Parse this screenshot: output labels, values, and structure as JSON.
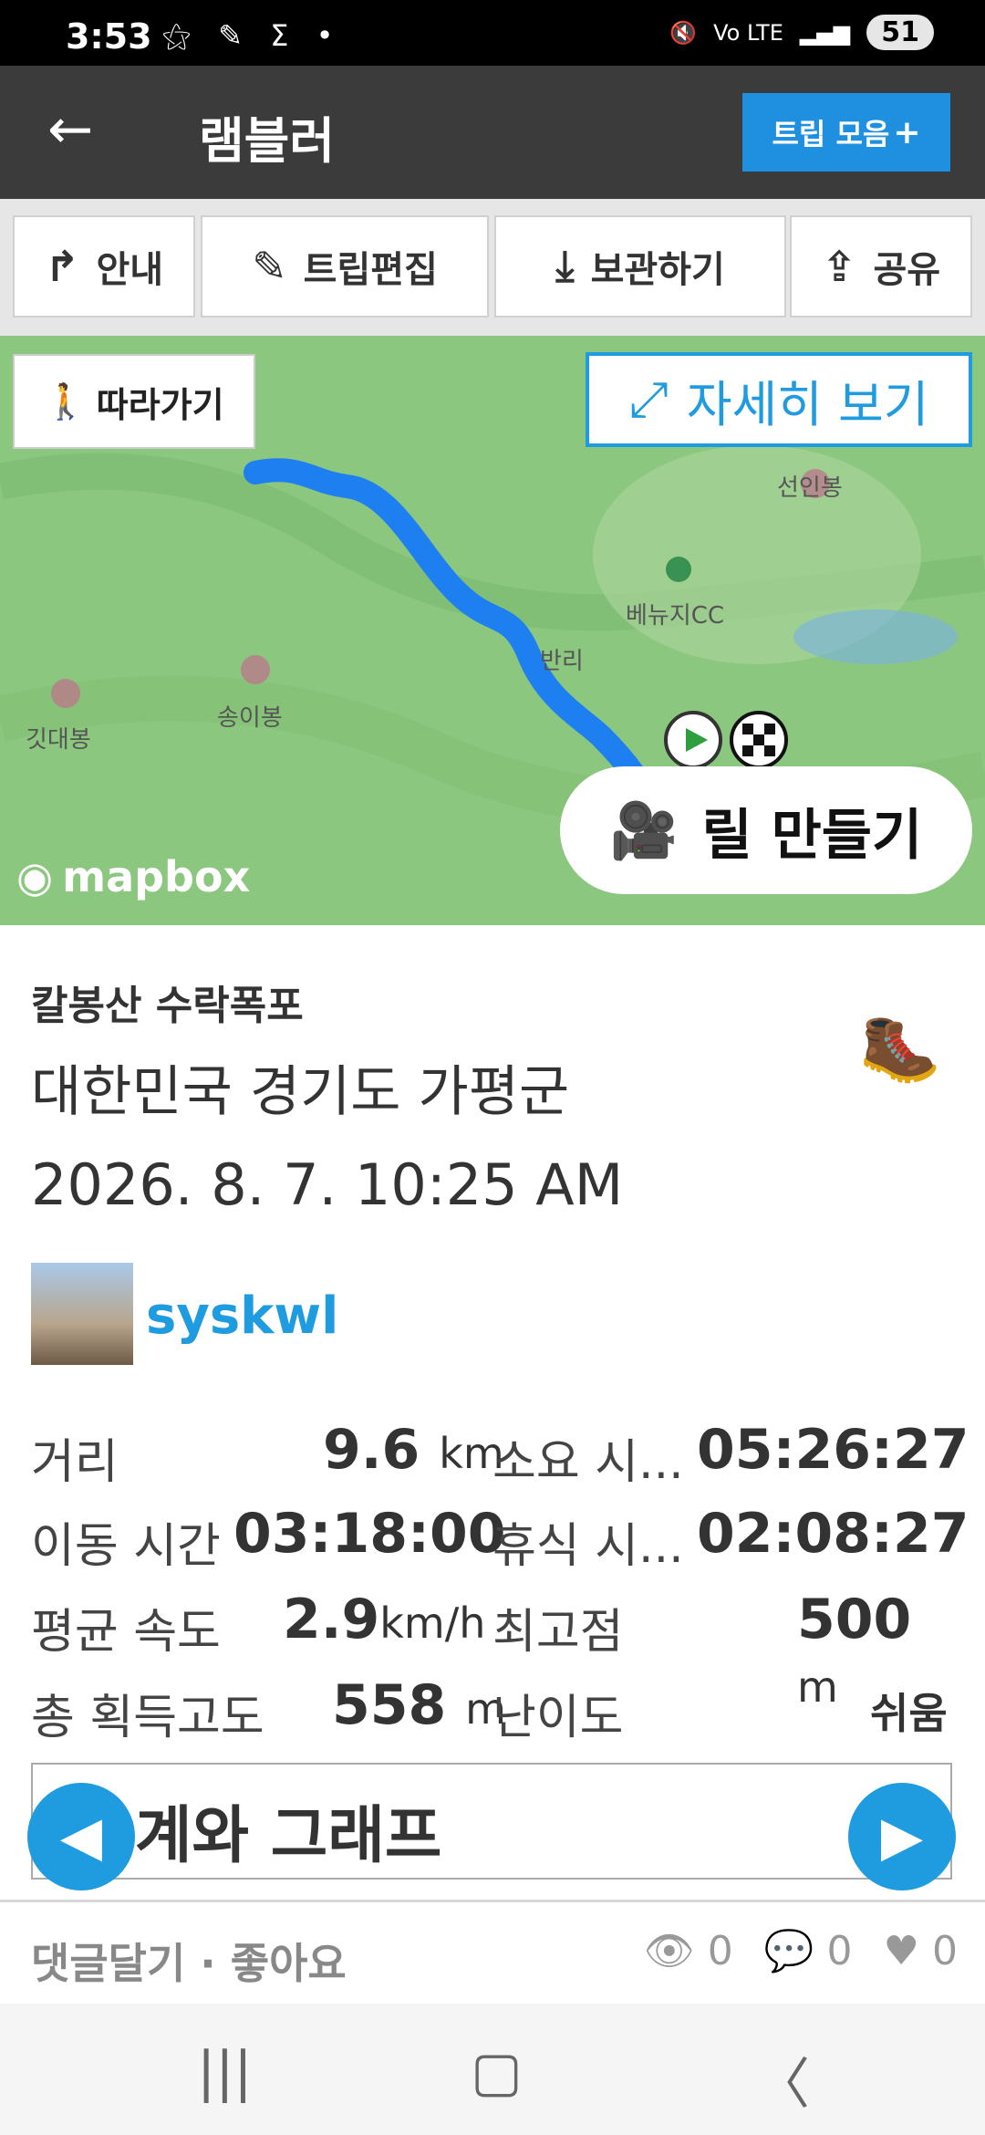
{
  "status_bar": {
    "time": "3:53",
    "left_icons": "⚝ ✎ Σ •",
    "signal": "Vo LTE",
    "battery": "51"
  },
  "app_bar": {
    "title": "램블러",
    "trips_button": "트립 모음"
  },
  "toolbar": {
    "guide": "안내",
    "edit_trip": "트립편집",
    "save": "보관하기",
    "share": "공유"
  },
  "map": {
    "follow": "따라가기",
    "detail_view": "자세히 보기",
    "labels": {
      "peak1": "선인봉",
      "cc": "베뉴지CC",
      "village": "반리",
      "peak2": "송이봉",
      "peak3": "깃대봉"
    },
    "mapbox": "mapbox",
    "reel_button": "릴 만들기"
  },
  "trip": {
    "name": "칼봉산 수락폭포",
    "location": "대한민국 경기도 가평군",
    "datetime": "2026. 8. 7. 10:25 AM",
    "username": "syskwl"
  },
  "stats": {
    "distance_label": "거리",
    "distance_value": "9.6",
    "distance_unit": "km",
    "duration_label": "소요 시...",
    "duration_value": "05:26:27",
    "moving_label": "이동 시간",
    "moving_value": "03:18:00",
    "rest_label": "휴식 시...",
    "rest_value": "02:08:27",
    "avg_speed_label": "평균 속도",
    "avg_speed_value": "2.9",
    "avg_speed_unit": "km/h",
    "max_elev_label": "최고점",
    "max_elev_value": "500",
    "max_elev_unit": "m",
    "gain_label": "총 획득고도",
    "gain_value": "558",
    "gain_unit": "m",
    "difficulty_label": "난이도",
    "difficulty_value": "쉬움"
  },
  "tab": {
    "title": "계와 그래프"
  },
  "footer": {
    "comments_likes": "댓글달기 · 좋아요",
    "views": "0",
    "comments": "0",
    "likes": "0"
  }
}
